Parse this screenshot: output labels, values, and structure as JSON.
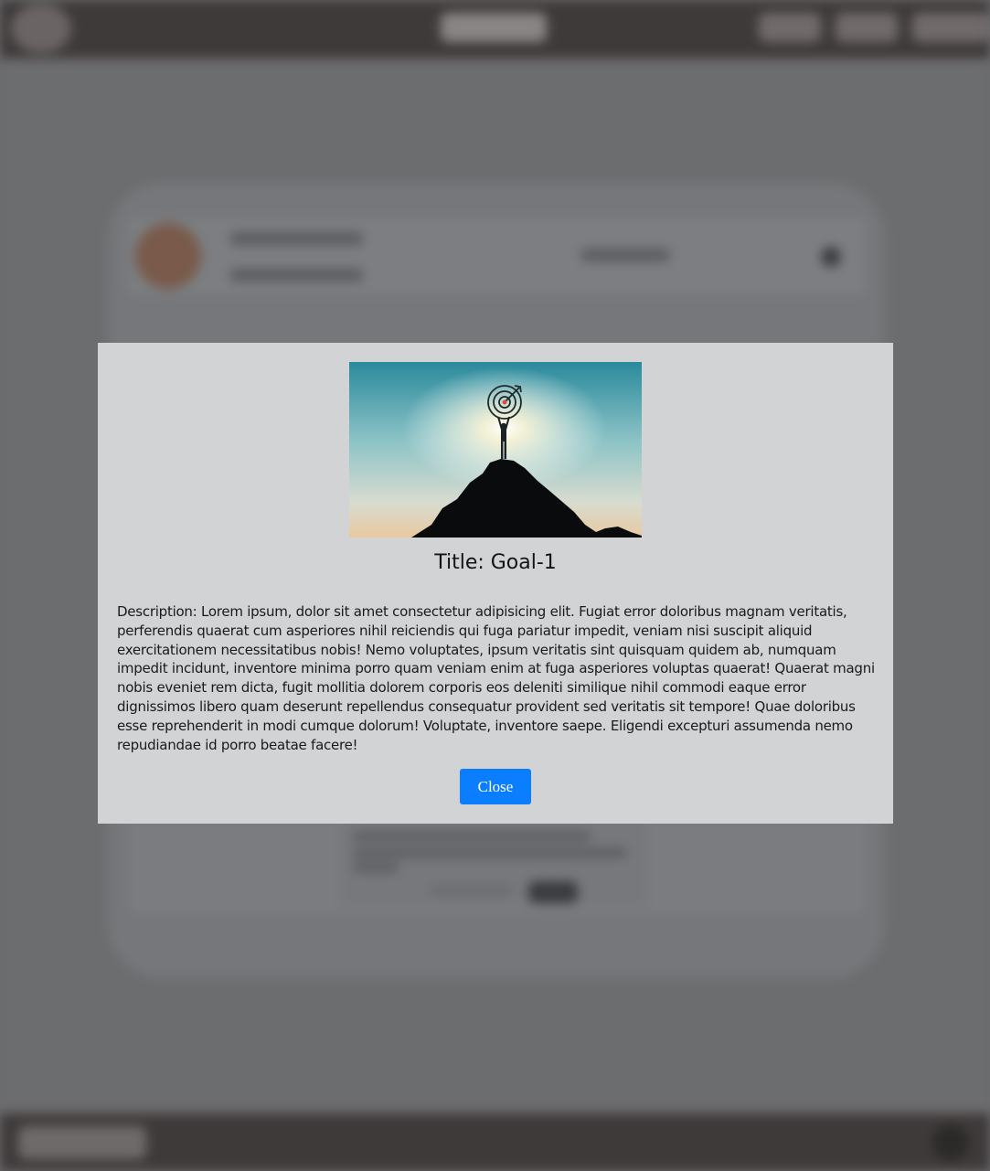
{
  "modal": {
    "title": "Title: Goal-1",
    "description": "Description: Lorem ipsum, dolor sit amet consectetur adipisicing elit. Fugiat error doloribus magnam veritatis, perferendis quaerat cum asperiores nihil reiciendis qui fuga pariatur impedit, veniam nisi suscipit aliquid exercitationem necessitatibus nobis! Nemo voluptates, ipsum veritatis sint quisquam quidem ab, numquam impedit incidunt, inventore minima porro quam veniam enim at fuga asperiores voluptas quaerat! Quaerat magni nobis eveniet rem dicta, fugit mollitia dolorem corporis eos deleniti similique nihil commodi eaque error dignissimos libero quam deserunt repellendus consequatur provident sed veritatis sit tempore! Quae doloribus esse reprehenderit in modi cumque dolorum! Voluptate, inventore saepe. Eligendi excepturi assumenda nemo repudiandae id porro beatae facere!",
    "close_label": "Close",
    "image_icon": "goal-mountain-image"
  },
  "colors": {
    "overlay": "#6a6b6d",
    "modal_bg": "#d1d3d5",
    "nav_bg": "#3f3a3a",
    "button": "#0b7dff"
  }
}
